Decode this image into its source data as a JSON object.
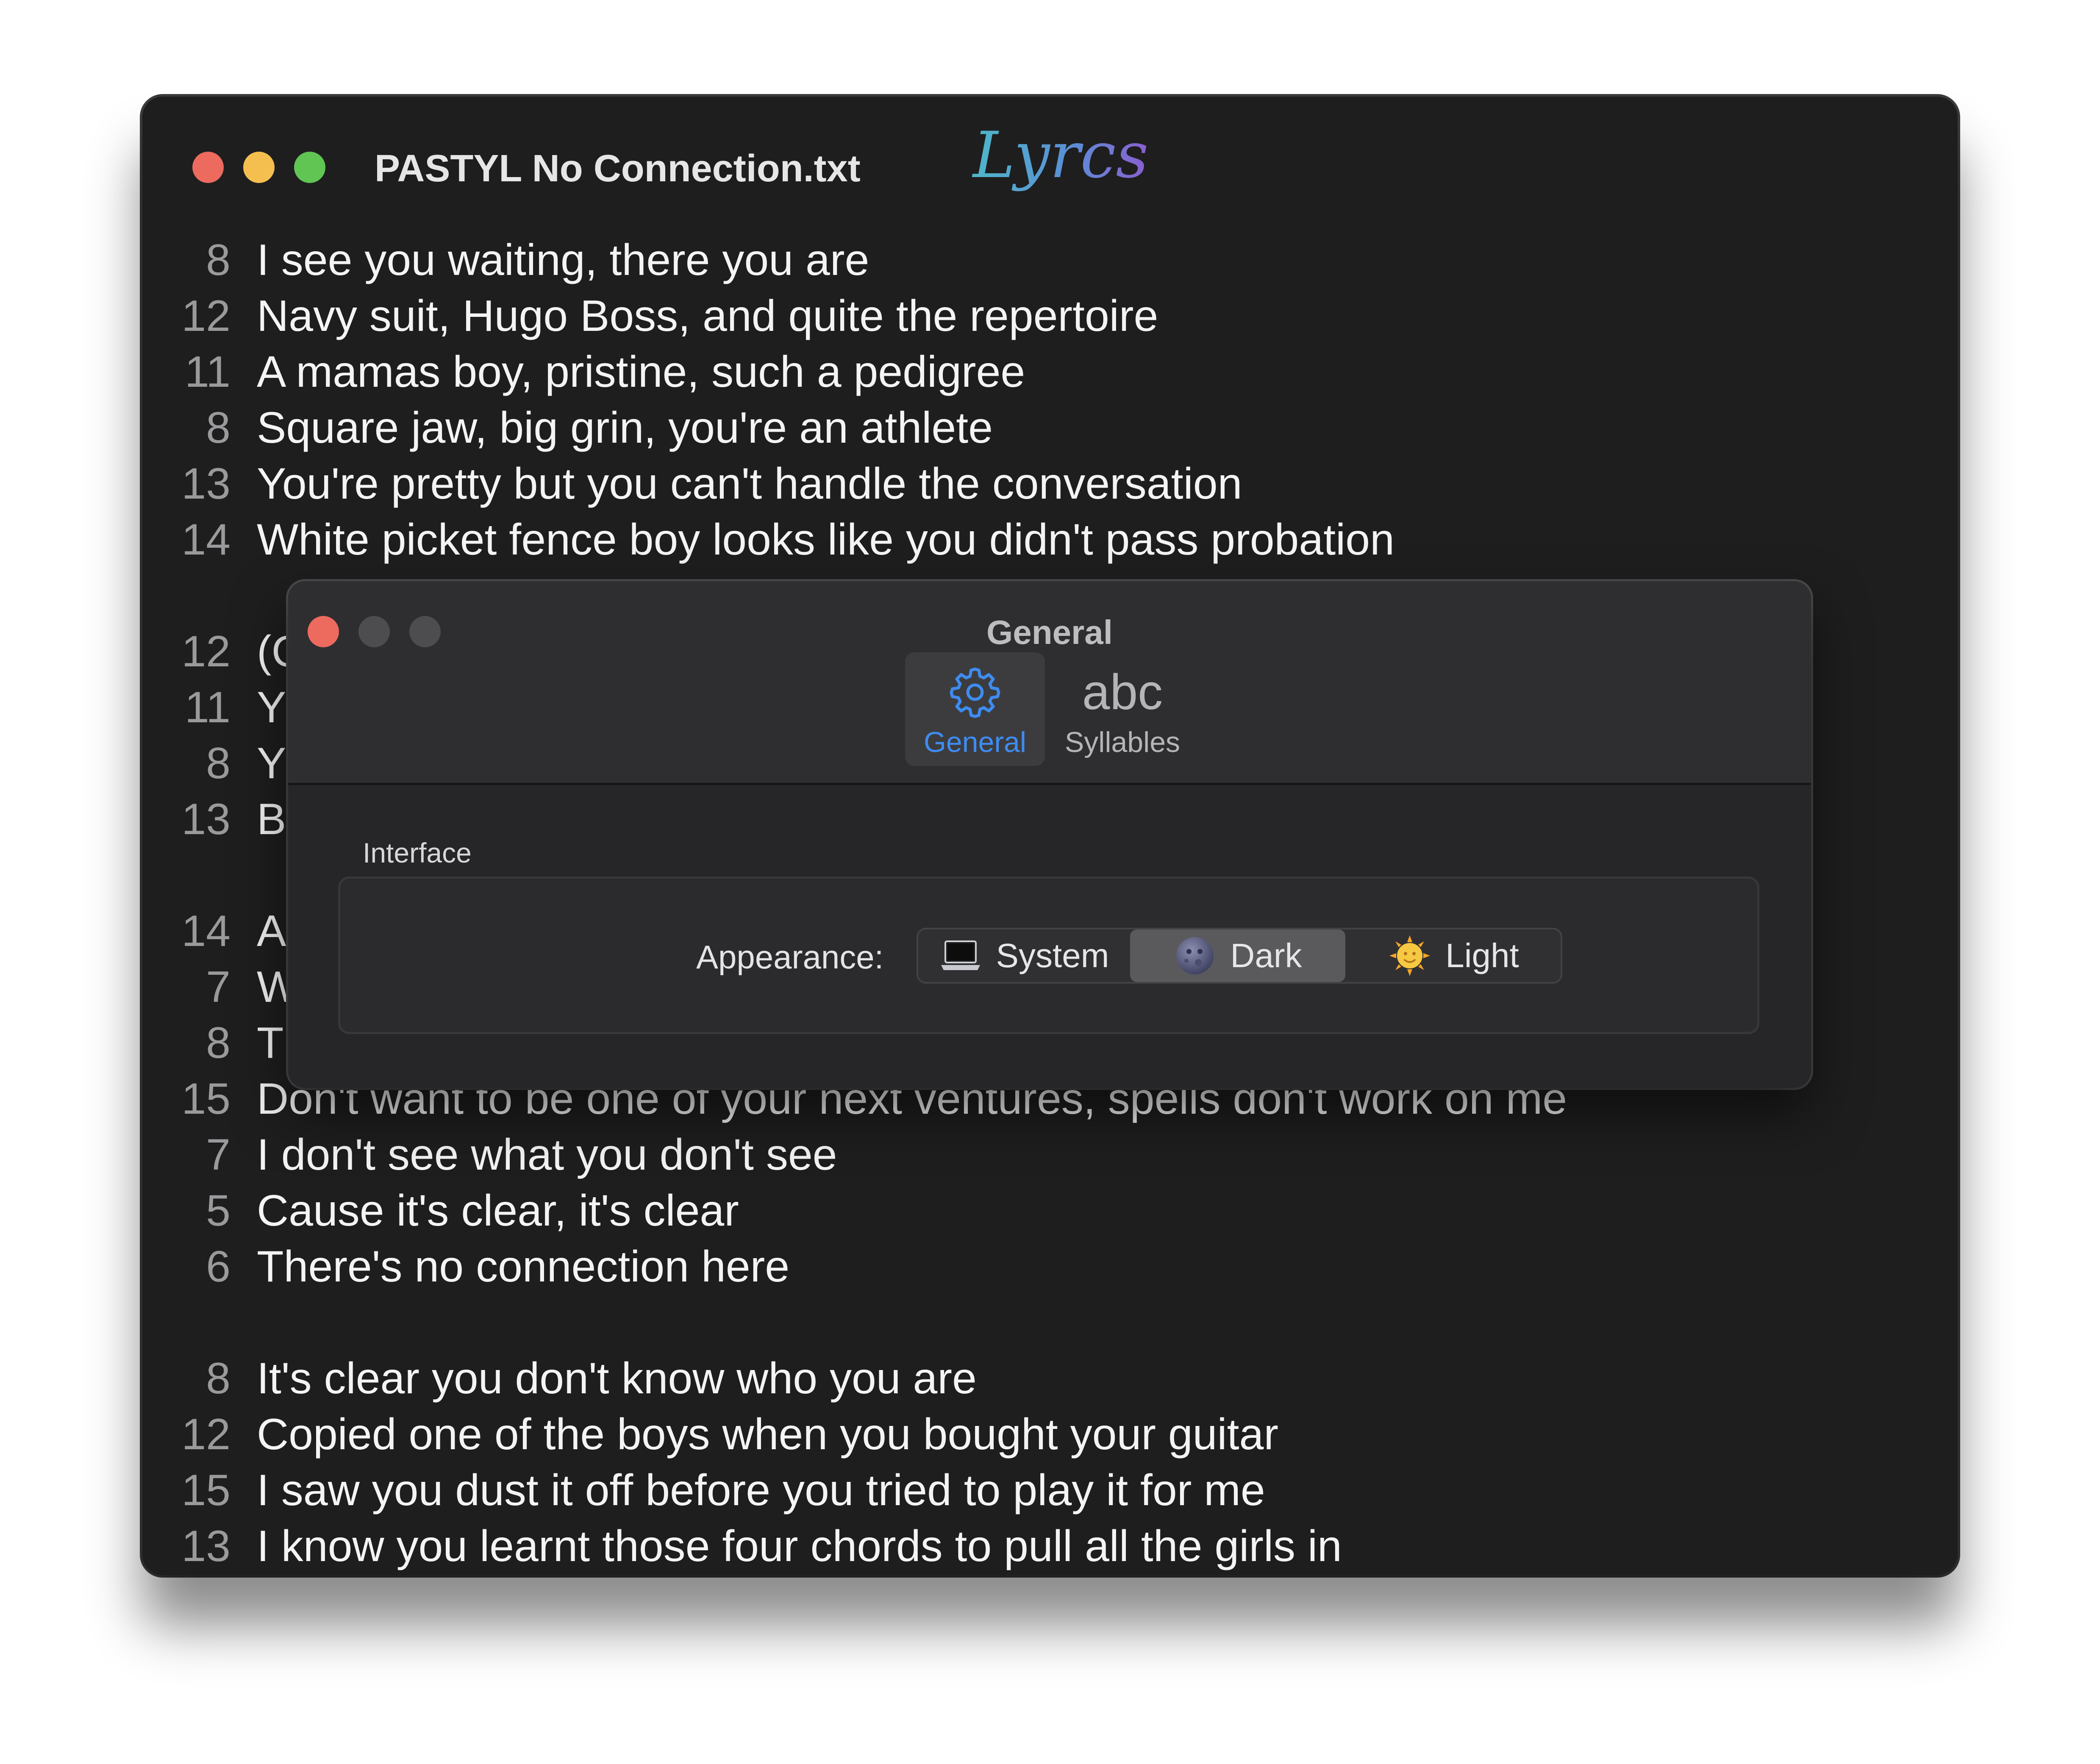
{
  "window": {
    "title": "PASTYL No Connection.txt",
    "logo_text": "Lyrcs"
  },
  "lyrics": [
    {
      "count": "8",
      "text": "I see you waiting, there you are"
    },
    {
      "count": "12",
      "text": "Navy suit, Hugo Boss, and quite the repertoire"
    },
    {
      "count": "11",
      "text": "A mamas boy, pristine, such a pedigree"
    },
    {
      "count": "8",
      "text": "Square jaw, big grin, you're an athlete"
    },
    {
      "count": "13",
      "text": "You're pretty but you can't handle the conversation"
    },
    {
      "count": "14",
      "text": "White picket fence boy looks like you didn't pass probation"
    },
    {
      "count": "",
      "text": ""
    },
    {
      "count": "12",
      "text": "(C"
    },
    {
      "count": "11",
      "text": "Y"
    },
    {
      "count": "8",
      "text": "Y"
    },
    {
      "count": "13",
      "text": "B"
    },
    {
      "count": "",
      "text": ""
    },
    {
      "count": "14",
      "text": "A"
    },
    {
      "count": "7",
      "text": "W"
    },
    {
      "count": "8",
      "text": "T"
    },
    {
      "count": "15",
      "text": "Don't want to be one of your next ventures, spells don't work on me"
    },
    {
      "count": "7",
      "text": "I don't see what you don't see"
    },
    {
      "count": "5",
      "text": "Cause it's clear, it's clear"
    },
    {
      "count": "6",
      "text": "There's no connection here"
    },
    {
      "count": "",
      "text": ""
    },
    {
      "count": "8",
      "text": "It's clear you don't know who you are"
    },
    {
      "count": "12",
      "text": "Copied one of the boys when you bought your guitar"
    },
    {
      "count": "15",
      "text": "I saw you dust it off before you tried to play it for me"
    },
    {
      "count": "13",
      "text": "I know you learnt those four chords to pull all the girls in"
    }
  ],
  "prefs": {
    "title": "General",
    "tabs": [
      {
        "label": "General",
        "icon": "gear-icon",
        "selected": true
      },
      {
        "label": "Syllables",
        "icon_text": "abc",
        "selected": false
      }
    ],
    "section_label": "Interface",
    "appearance_label": "Appearance:",
    "appearance_options": [
      {
        "label": "System",
        "icon": "laptop-icon",
        "selected": false
      },
      {
        "label": "Dark",
        "icon": "moon-icon",
        "selected": true
      },
      {
        "label": "Light",
        "icon": "sun-icon",
        "selected": false
      }
    ]
  },
  "colors": {
    "window_bg": "#1e1e1f",
    "accent": "#3e8cf0",
    "close": "#ed6a5e",
    "minimize": "#f5bf4f",
    "zoom": "#61c554"
  }
}
